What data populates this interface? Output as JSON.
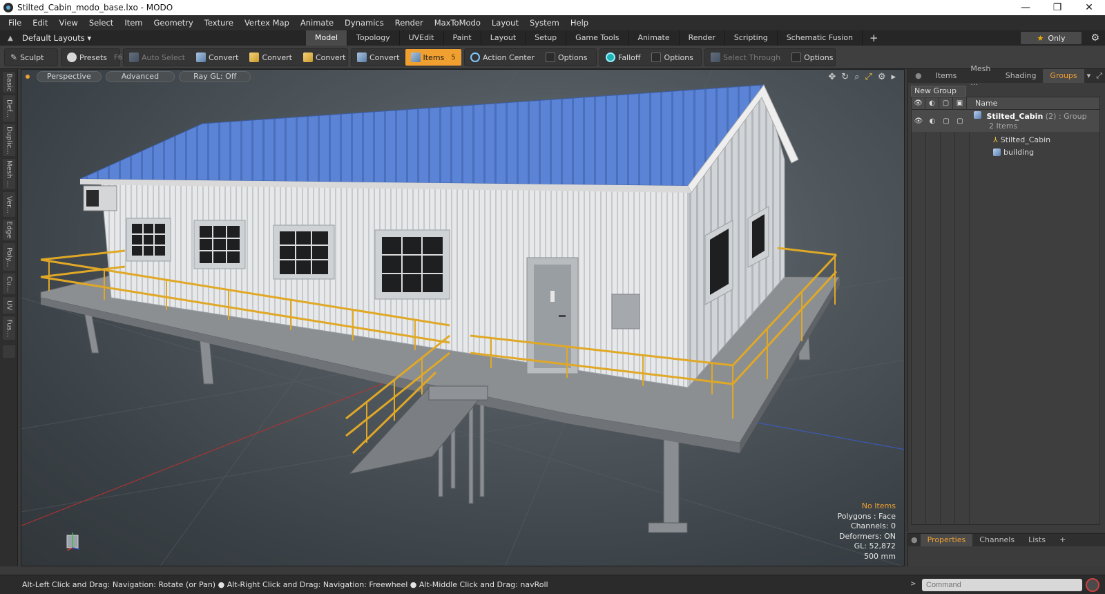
{
  "window": {
    "title": "Stilted_Cabin_modo_base.lxo - MODO",
    "minimize_glyph": "—",
    "restore_glyph": "❐",
    "close_glyph": "✕"
  },
  "menu": [
    "File",
    "Edit",
    "View",
    "Select",
    "Item",
    "Geometry",
    "Texture",
    "Vertex Map",
    "Animate",
    "Dynamics",
    "Render",
    "MaxToModo",
    "Layout",
    "System",
    "Help"
  ],
  "layout_bar": {
    "dropdown": "Default Layouts ▾",
    "tabs": [
      "Model",
      "Topology",
      "UVEdit",
      "Paint",
      "Layout",
      "Setup",
      "Game Tools",
      "Animate",
      "Render",
      "Scripting",
      "Schematic Fusion"
    ],
    "active_tab": "Model",
    "only_label": "Only"
  },
  "toolbar": {
    "sculpt": "Sculpt",
    "presets": "Presets",
    "presets_shortcut": "F6",
    "auto_select": "Auto Select",
    "convert1": "Convert",
    "convert2": "Convert",
    "convert3": "Convert",
    "convert4": "Convert",
    "items": "Items",
    "items_shortcut": "5",
    "action_center": "Action Center",
    "options1": "Options",
    "falloff": "Falloff",
    "options2": "Options",
    "select_through": "Select Through",
    "options3": "Options"
  },
  "left_tabs": [
    "Basic",
    "Def...",
    "Duplic...",
    "Mesh ...",
    "Ver...",
    "Edge",
    "Poly...",
    "Cu...",
    "UV",
    "Fus..."
  ],
  "viewport": {
    "view_mode": "Perspective",
    "shading": "Advanced",
    "raygl": "Ray GL: Off",
    "stats": {
      "no_items": "No Items",
      "polygons": "Polygons : Face",
      "channels": "Channels: 0",
      "deformers": "Deformers: ON",
      "gl": "GL: 52,872",
      "scale": "500 mm"
    },
    "colors": {
      "roof": "#5b84d6",
      "walls": "#e4e6e8",
      "railing": "#e0a826",
      "deck": "#8b8f92"
    }
  },
  "right_panel": {
    "tabs": [
      "Items",
      "Mesh ...",
      "Shading",
      "Groups"
    ],
    "active_tab": "Groups",
    "new_group": "New Group",
    "column_name": "Name",
    "tree": {
      "group_name": "Stilted_Cabin",
      "group_count": "(2)",
      "group_type": ": Group",
      "group_sub": "2 Items",
      "children": [
        "Stilted_Cabin",
        "building"
      ]
    }
  },
  "bottom_panel": {
    "tabs": [
      "Properties",
      "Channels",
      "Lists"
    ],
    "active_tab": "Properties",
    "plus": "+"
  },
  "status": {
    "hint": "Alt-Left Click and Drag: Navigation: Rotate (or Pan) ● Alt-Right Click and Drag: Navigation: Freewheel ● Alt-Middle Click and Drag: navRoll",
    "command_placeholder": "Command"
  }
}
